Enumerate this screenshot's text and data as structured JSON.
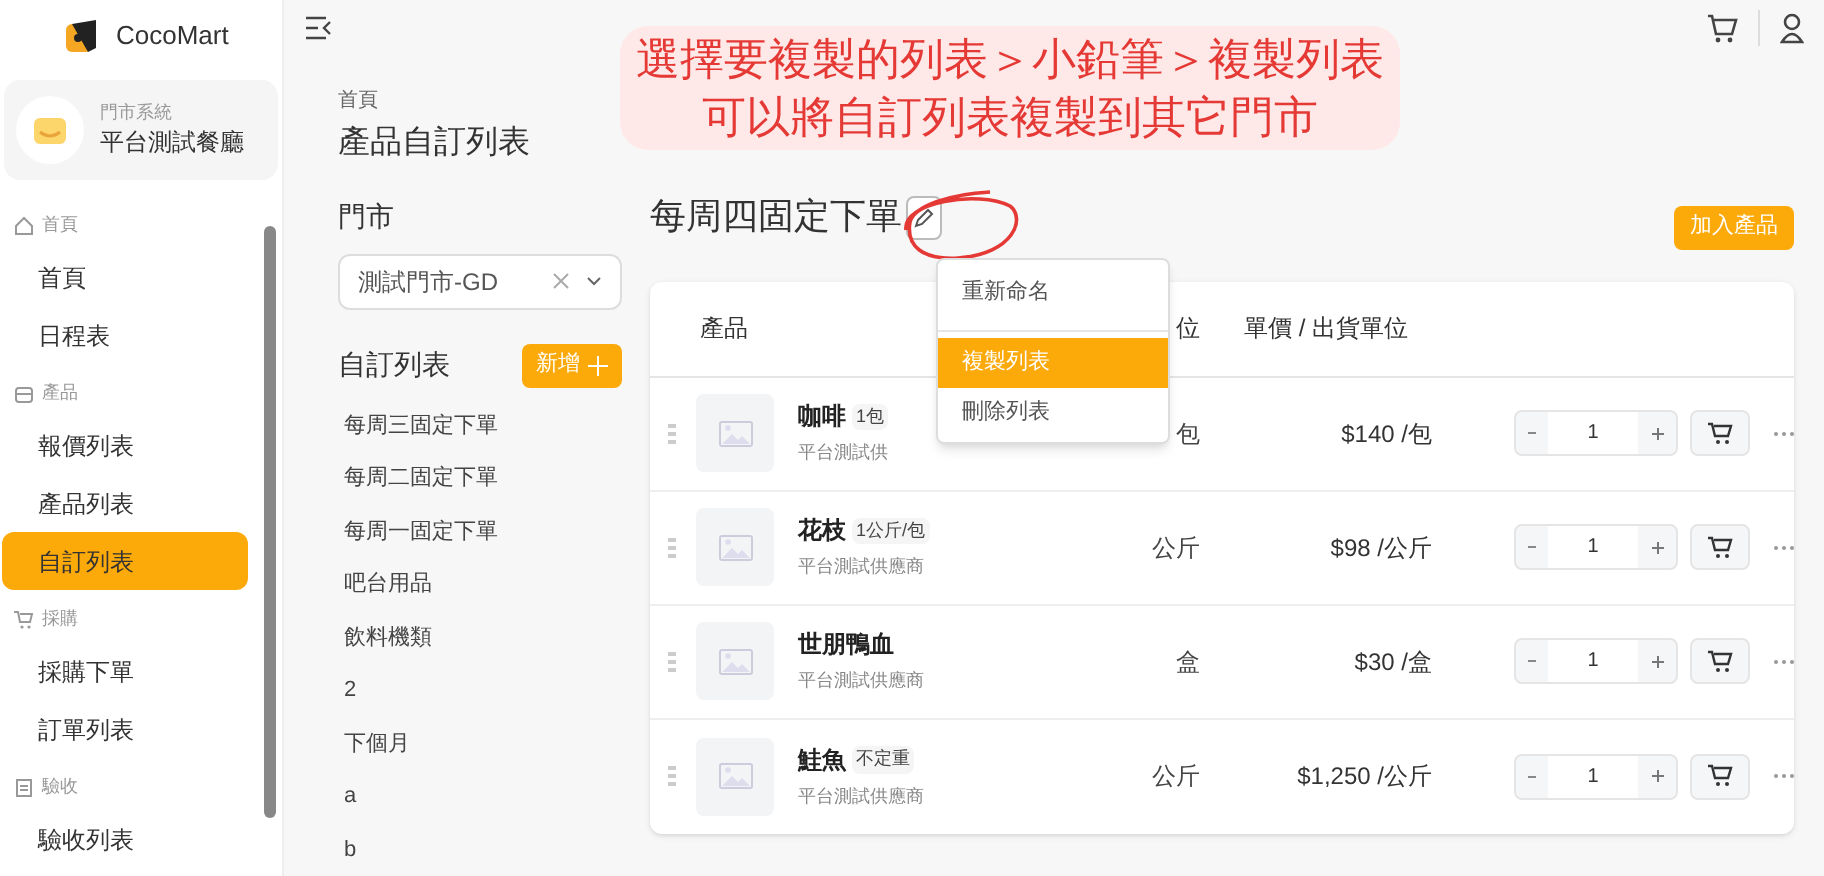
{
  "brand": "CocoMart",
  "store_card": {
    "label": "門市系統",
    "name": "平台測試餐廳"
  },
  "sidebar": [
    {
      "kind": "section",
      "label": "首頁"
    },
    {
      "kind": "item",
      "label": "首頁",
      "selected": false
    },
    {
      "kind": "item",
      "label": "日程表",
      "selected": false
    },
    {
      "kind": "section",
      "label": "產品"
    },
    {
      "kind": "item",
      "label": "報價列表",
      "selected": false
    },
    {
      "kind": "item",
      "label": "產品列表",
      "selected": false
    },
    {
      "kind": "item",
      "label": "自訂列表",
      "selected": true
    },
    {
      "kind": "section",
      "label": "採購"
    },
    {
      "kind": "item",
      "label": "採購下單",
      "selected": false
    },
    {
      "kind": "item",
      "label": "訂單列表",
      "selected": false
    },
    {
      "kind": "section",
      "label": "驗收"
    },
    {
      "kind": "item",
      "label": "驗收列表",
      "selected": false
    }
  ],
  "breadcrumb": "首頁",
  "page_title": "產品自訂列表",
  "annotation": [
    "選擇要複製的列表＞小鉛筆＞複製列表",
    "可以將自訂列表複製到其它門市"
  ],
  "store_label": "門市",
  "store_select": {
    "value": "測試門市-GD"
  },
  "lists_title": "自訂列表",
  "new_button": "新增",
  "lists": [
    "每周三固定下單",
    "每周二固定下單",
    "每周一固定下單",
    "吧台用品",
    "飲料機類",
    "2",
    "下個月",
    "a",
    "b"
  ],
  "list_title": "每周四固定下單",
  "add_button": "加入產品",
  "menu": [
    {
      "label": "重新命名",
      "selected": false
    },
    {
      "label": "複製列表",
      "selected": true
    },
    {
      "label": "刪除列表",
      "selected": false
    }
  ],
  "table": {
    "columns": [
      "產品",
      "位",
      "單價 / 出貨單位"
    ],
    "rows": [
      {
        "name": "咖啡",
        "tag": "1包",
        "supplier": "平台測試供",
        "unit": "包",
        "price": "$140 /包",
        "qty": "1"
      },
      {
        "name": "花枝",
        "tag": "1公斤/包",
        "supplier": "平台測試供應商",
        "unit": "公斤",
        "price": "$98 /公斤",
        "qty": "1"
      },
      {
        "name": "世朋鴨血",
        "supplier": "平台測試供應商",
        "unit": "盒",
        "price": "$30 /盒",
        "qty": "1"
      },
      {
        "name": "鮭魚",
        "tag": "不定重",
        "supplier": "平台測試供應商",
        "unit": "公斤",
        "price": "$1,250 /公斤",
        "qty": "1"
      }
    ]
  }
}
